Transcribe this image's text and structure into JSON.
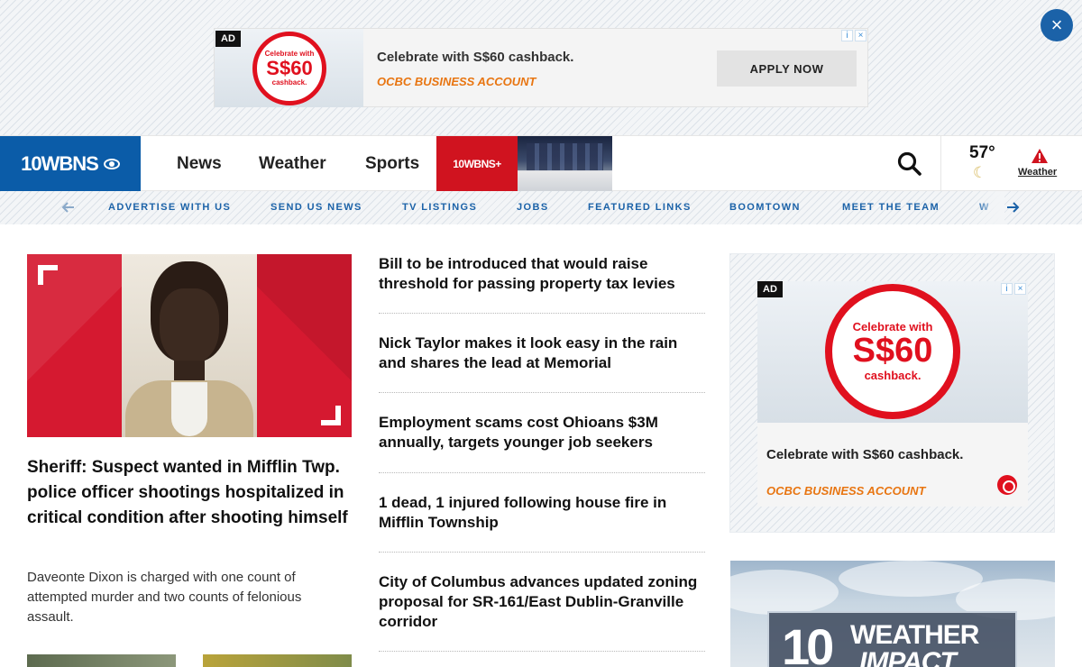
{
  "top_ad": {
    "badge": "AD",
    "ring_line1": "Celebrate with",
    "ring_line2": "S$60",
    "ring_line3": "cashback.",
    "headline": "Celebrate with S$60 cashback.",
    "brand": "OCBC BUSINESS ACCOUNT",
    "cta": "APPLY NOW"
  },
  "close_icon": "×",
  "logo": {
    "text": "10WBNS"
  },
  "nav": {
    "links": [
      "News",
      "Weather",
      "Sports"
    ],
    "plus_label": "10WBNS+"
  },
  "weather": {
    "temp": "57°",
    "condition_icon": "moon-cloud-icon",
    "alert_icon": "!",
    "link": "Weather"
  },
  "subnav": {
    "items": [
      "ADVERTISE WITH US",
      "SEND US NEWS",
      "TV LISTINGS",
      "JOBS",
      "FEATURED LINKS",
      "BOOMTOWN",
      "MEET THE TEAM",
      "W"
    ]
  },
  "lead": {
    "headline": "Sheriff: Suspect wanted in Mifflin Twp. police officer shootings hospitalized in critical condition after shooting himself",
    "summary": "Daveonte Dixon is charged with one count of attempted murder and two counts of felonious assault."
  },
  "headlines": [
    "Bill to be introduced that would raise threshold for passing property tax levies",
    "Nick Taylor makes it look easy in the rain and shares the lead at Memorial",
    "Employment scams cost Ohioans $3M annually, targets younger job seekers",
    "1 dead, 1 injured following house fire in Mifflin Township",
    "City of Columbus advances updated zoning proposal for SR-161/East Dublin-Granville corridor"
  ],
  "side_ad": {
    "badge": "AD",
    "ring_line1": "Celebrate with",
    "ring_line2": "S$60",
    "ring_line3": "cashback.",
    "headline": "Celebrate with S$60 cashback.",
    "brand": "OCBC BUSINESS ACCOUNT"
  },
  "wx_promo": {
    "num": "10",
    "word1": "WEATHER",
    "word2": "IMPACT"
  },
  "colors": {
    "brand_blue": "#0b5ca8",
    "link_blue": "#1b62a8",
    "red": "#d0131f",
    "ocbc_red": "#e0101e",
    "ocbc_orange": "#e87511"
  }
}
